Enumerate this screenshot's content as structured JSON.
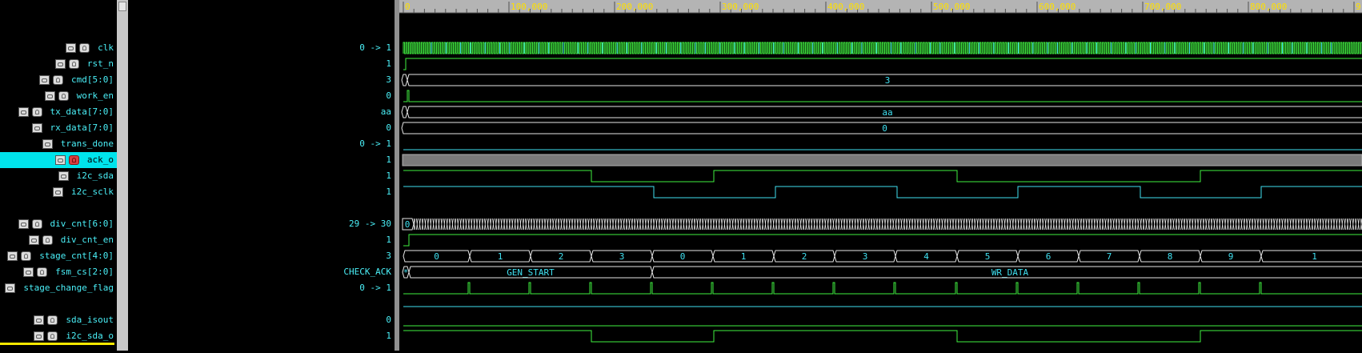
{
  "signals": [
    {
      "name": "clk",
      "value": "0 -> 1",
      "kind": "var"
    },
    {
      "name": "rst_n",
      "value": "1",
      "kind": "var"
    },
    {
      "name": "cmd[5:0]",
      "value": "3",
      "kind": "var"
    },
    {
      "name": "work_en",
      "value": "0",
      "kind": "var"
    },
    {
      "name": "tx_data[7:0]",
      "value": "aa",
      "kind": "var"
    },
    {
      "name": "rx_data[7:0]",
      "value": "0",
      "kind": "net"
    },
    {
      "name": "trans_done",
      "value": "0 -> 1",
      "kind": "net"
    },
    {
      "name": "ack_o",
      "value": "1",
      "kind": "var",
      "selected": true
    },
    {
      "name": "i2c_sda",
      "value": "1",
      "kind": "net"
    },
    {
      "name": "i2c_sclk",
      "value": "1",
      "kind": "net"
    },
    {
      "name": "div_cnt[6:0]",
      "value": "29 -> 30",
      "kind": "var"
    },
    {
      "name": "div_cnt_en",
      "value": "1",
      "kind": "var"
    },
    {
      "name": "stage_cnt[4:0]",
      "value": "3",
      "kind": "var"
    },
    {
      "name": "fsm_cs[2:0]",
      "value": "CHECK_ACK",
      "kind": "var"
    },
    {
      "name": "stage_change_flag",
      "value": "0 -> 1",
      "kind": "net"
    },
    {
      "name": "sda_isout",
      "value": "0",
      "kind": "var"
    },
    {
      "name": "i2c_sda_o",
      "value": "1",
      "kind": "var"
    }
  ],
  "timeline": {
    "ticks": [
      "0",
      "100,000",
      "200,000",
      "300,000",
      "400,000",
      "500,000",
      "600,000",
      "700,000",
      "800,000",
      "9"
    ]
  },
  "bus_labels": {
    "cmd": "3",
    "tx_data": "aa",
    "rx_data": "0",
    "div_cnt_start": "0",
    "stage_cnt": [
      "0",
      "1",
      "2",
      "3",
      "0",
      "1",
      "2",
      "3",
      "4",
      "5",
      "6",
      "7",
      "8",
      "9",
      "1"
    ],
    "fsm_cs_first": "*",
    "fsm_gen_start": "GEN_START",
    "fsm_wr_data": "WR_DATA"
  },
  "colors": {
    "background": "#000000",
    "signal_name": "#4af0f8",
    "wave_green": "#40f040",
    "wave_cyan": "#40e0f0",
    "bus_outline": "#e6e6e6",
    "selected_row": "#00e4ec",
    "ruler": "#b4b4b4",
    "ruler_text": "#ffe000",
    "underline": "#f8e800"
  }
}
